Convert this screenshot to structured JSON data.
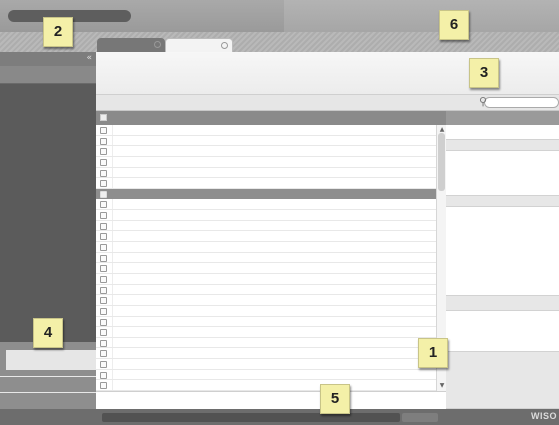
{
  "sidebar": {
    "collapse_icon": "double-chevron-left-icon",
    "collapse_glyph": "«"
  },
  "toolbar": {
    "search_icon": "magnifier-icon",
    "search_glyph": "⚲"
  },
  "list": {
    "rows": 25,
    "selected_index": 6
  },
  "scrollbar": {
    "up_glyph": "▲",
    "down_glyph": "▼"
  },
  "branding": {
    "logo_text": "WISO"
  },
  "callouts": {
    "c1": "1",
    "c2": "2",
    "c3": "3",
    "c4": "4",
    "c5": "5",
    "c6": "6"
  },
  "colors": {
    "callout_bg": "#f4f0a8",
    "sidebar_bg": "#5b5b5b",
    "selected_row": "#8e8e8e"
  }
}
